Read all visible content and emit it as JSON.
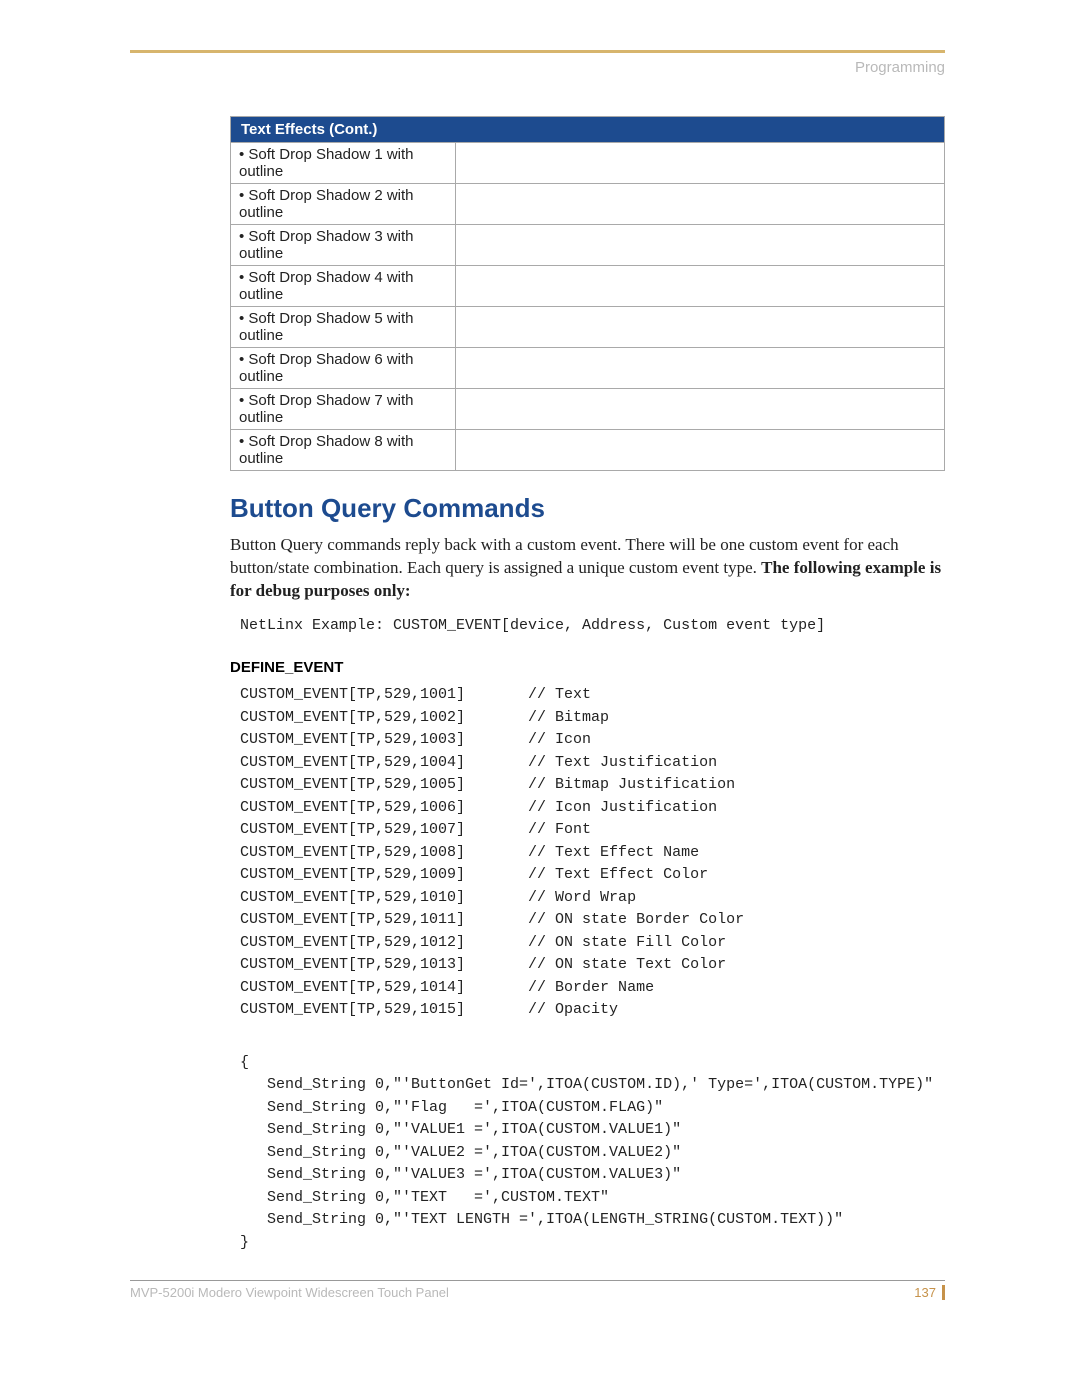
{
  "header": {
    "section": "Programming"
  },
  "table": {
    "title": "Text Effects (Cont.)",
    "rows": [
      "• Soft Drop Shadow 1 with outline",
      "• Soft Drop Shadow 2 with outline",
      "• Soft Drop Shadow 3 with outline",
      "• Soft Drop Shadow 4 with outline",
      "• Soft Drop Shadow 5 with outline",
      "• Soft Drop Shadow 6 with outline",
      "• Soft Drop Shadow 7 with outline",
      "• Soft Drop Shadow 8 with outline"
    ]
  },
  "heading": "Button Query Commands",
  "para_plain": "Button Query commands reply back with a custom event. There will be one custom event for each button/state combination. Each query is assigned a unique custom event type. ",
  "para_bold": "The following example is for debug purposes only:",
  "code_intro": "NetLinx Example: CUSTOM_EVENT[device, Address, Custom event type]",
  "define_label": "DEFINE_EVENT",
  "events": [
    {
      "code": "CUSTOM_EVENT[TP,529,1001]",
      "comment": "// Text"
    },
    {
      "code": "CUSTOM_EVENT[TP,529,1002]",
      "comment": "// Bitmap"
    },
    {
      "code": "CUSTOM_EVENT[TP,529,1003]",
      "comment": "// Icon"
    },
    {
      "code": "CUSTOM_EVENT[TP,529,1004]",
      "comment": "// Text Justification"
    },
    {
      "code": "CUSTOM_EVENT[TP,529,1005]",
      "comment": "// Bitmap Justification"
    },
    {
      "code": "CUSTOM_EVENT[TP,529,1006]",
      "comment": "// Icon Justification"
    },
    {
      "code": "CUSTOM_EVENT[TP,529,1007]",
      "comment": "// Font"
    },
    {
      "code": "CUSTOM_EVENT[TP,529,1008]",
      "comment": "// Text Effect Name"
    },
    {
      "code": "CUSTOM_EVENT[TP,529,1009]",
      "comment": "// Text Effect Color"
    },
    {
      "code": "CUSTOM_EVENT[TP,529,1010]",
      "comment": "// Word Wrap"
    },
    {
      "code": "CUSTOM_EVENT[TP,529,1011]",
      "comment": "// ON state Border Color"
    },
    {
      "code": "CUSTOM_EVENT[TP,529,1012]",
      "comment": "// ON state Fill Color"
    },
    {
      "code": "CUSTOM_EVENT[TP,529,1013]",
      "comment": "// ON state Text Color"
    },
    {
      "code": "CUSTOM_EVENT[TP,529,1014]",
      "comment": "// Border Name"
    },
    {
      "code": "CUSTOM_EVENT[TP,529,1015]",
      "comment": "// Opacity"
    }
  ],
  "block": [
    "{",
    "   Send_String 0,\"'ButtonGet Id=',ITOA(CUSTOM.ID),' Type=',ITOA(CUSTOM.TYPE)\"",
    "   Send_String 0,\"'Flag   =',ITOA(CUSTOM.FLAG)\"",
    "   Send_String 0,\"'VALUE1 =',ITOA(CUSTOM.VALUE1)\"",
    "   Send_String 0,\"'VALUE2 =',ITOA(CUSTOM.VALUE2)\"",
    "   Send_String 0,\"'VALUE3 =',ITOA(CUSTOM.VALUE3)\"",
    "   Send_String 0,\"'TEXT   =',CUSTOM.TEXT\"",
    "   Send_String 0,\"'TEXT LENGTH =',ITOA(LENGTH_STRING(CUSTOM.TEXT))\"",
    "}"
  ],
  "footer": {
    "title": "MVP-5200i Modero Viewpoint Widescreen Touch Panel",
    "page": "137"
  }
}
